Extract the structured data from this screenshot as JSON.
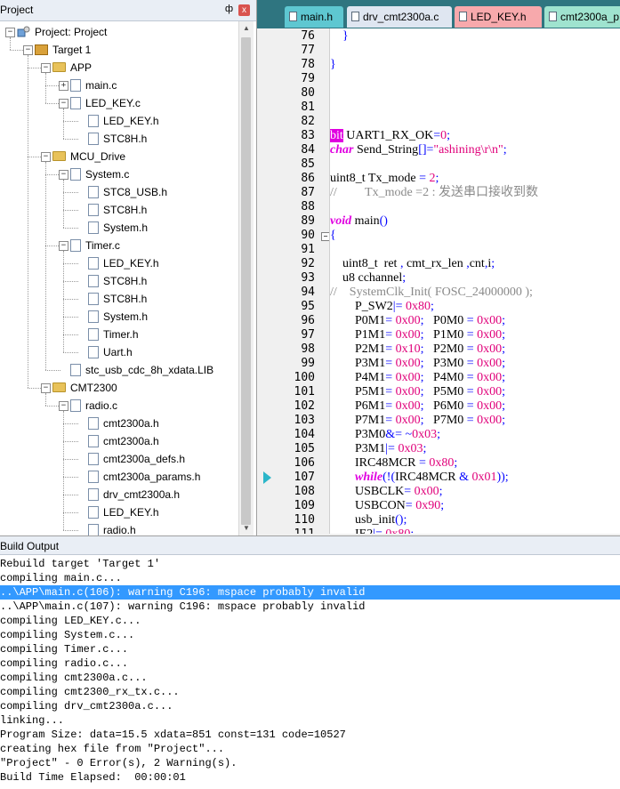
{
  "project_panel": {
    "title": "Project",
    "pin": "ф",
    "close": "x",
    "tree": [
      {
        "label": "Project: Project",
        "type": "project",
        "depth": 0,
        "expander": "−"
      },
      {
        "label": "Target 1",
        "type": "target",
        "depth": 1,
        "expander": "−"
      },
      {
        "label": "APP",
        "type": "folder",
        "depth": 2,
        "expander": "−"
      },
      {
        "label": "main.c",
        "type": "file",
        "depth": 3,
        "expander": "+"
      },
      {
        "label": "LED_KEY.c",
        "type": "file",
        "depth": 3,
        "expander": "−"
      },
      {
        "label": "LED_KEY.h",
        "type": "file",
        "depth": 4
      },
      {
        "label": "STC8H.h",
        "type": "file",
        "depth": 4
      },
      {
        "label": "MCU_Drive",
        "type": "folder",
        "depth": 2,
        "expander": "−"
      },
      {
        "label": "System.c",
        "type": "file",
        "depth": 3,
        "expander": "−"
      },
      {
        "label": "STC8_USB.h",
        "type": "file",
        "depth": 4
      },
      {
        "label": "STC8H.h",
        "type": "file",
        "depth": 4
      },
      {
        "label": "System.h",
        "type": "file",
        "depth": 4
      },
      {
        "label": "Timer.c",
        "type": "file",
        "depth": 3,
        "expander": "−"
      },
      {
        "label": "LED_KEY.h",
        "type": "file",
        "depth": 4
      },
      {
        "label": "STC8H.h",
        "type": "file",
        "depth": 4
      },
      {
        "label": "STC8H.h",
        "type": "file",
        "depth": 4
      },
      {
        "label": "System.h",
        "type": "file",
        "depth": 4
      },
      {
        "label": "Timer.h",
        "type": "file",
        "depth": 4
      },
      {
        "label": "Uart.h",
        "type": "file",
        "depth": 4
      },
      {
        "label": "stc_usb_cdc_8h_xdata.LIB",
        "type": "file",
        "depth": 3
      },
      {
        "label": "CMT2300",
        "type": "folder",
        "depth": 2,
        "expander": "−"
      },
      {
        "label": "radio.c",
        "type": "file",
        "depth": 3,
        "expander": "−"
      },
      {
        "label": "cmt2300a.h",
        "type": "file",
        "depth": 4
      },
      {
        "label": "cmt2300a.h",
        "type": "file",
        "depth": 4
      },
      {
        "label": "cmt2300a_defs.h",
        "type": "file",
        "depth": 4
      },
      {
        "label": "cmt2300a_params.h",
        "type": "file",
        "depth": 4
      },
      {
        "label": "drv_cmt2300a.h",
        "type": "file",
        "depth": 4
      },
      {
        "label": "LED_KEY.h",
        "type": "file",
        "depth": 4
      },
      {
        "label": "radio.h",
        "type": "file",
        "depth": 4
      }
    ]
  },
  "editor": {
    "tabs": [
      {
        "label": "main.h",
        "color": "#5ec7d1",
        "active": true
      },
      {
        "label": "drv_cmt2300a.c",
        "color": "#dfe6f1",
        "active": false
      },
      {
        "label": "LED_KEY.h",
        "color": "#f7a9ac",
        "active": false
      },
      {
        "label": "cmt2300a_p",
        "color": "#9fe3cf",
        "active": false
      }
    ],
    "line_numbers": [
      "76",
      "77",
      "78",
      "79",
      "80",
      "81",
      "82",
      "83",
      "84",
      "85",
      "86",
      "87",
      "88",
      "89",
      "90",
      "91",
      "92",
      "93",
      "94",
      "95",
      "96",
      "97",
      "98",
      "99",
      "100",
      "101",
      "102",
      "103",
      "104",
      "105",
      "106",
      "107",
      "108",
      "109",
      "110",
      "111"
    ],
    "fold_markers": [
      {
        "line": "90",
        "symbol": "−"
      }
    ],
    "current_line_marker": "107",
    "code_lines": [
      [
        {
          "t": "    "
        },
        {
          "t": "}",
          "c": "br"
        }
      ],
      [
        {
          "t": ""
        }
      ],
      [
        {
          "t": "}",
          "c": "br"
        }
      ],
      [
        {
          "t": ""
        }
      ],
      [
        {
          "t": ""
        }
      ],
      [
        {
          "t": ""
        }
      ],
      [
        {
          "t": ""
        }
      ],
      [
        {
          "t": "bit",
          "c": "bitkw"
        },
        {
          "t": " UART1_RX_OK"
        },
        {
          "t": "=",
          "c": "op"
        },
        {
          "t": "0",
          "c": "num"
        },
        {
          "t": ";",
          "c": "op"
        }
      ],
      [
        {
          "t": "char",
          "c": "kw"
        },
        {
          "t": " Send_String"
        },
        {
          "t": "[]=",
          "c": "op"
        },
        {
          "t": "\"ashining\\r\\n\"",
          "c": "str"
        },
        {
          "t": ";",
          "c": "op"
        }
      ],
      [
        {
          "t": ""
        }
      ],
      [
        {
          "t": "uint8_t Tx_mode "
        },
        {
          "t": "=",
          "c": "op"
        },
        {
          "t": " "
        },
        {
          "t": "2",
          "c": "num"
        },
        {
          "t": ";",
          "c": "op"
        }
      ],
      [
        {
          "t": "//         Tx_mode =2 : 发送串口接收到数",
          "c": "cm"
        }
      ],
      [
        {
          "t": ""
        }
      ],
      [
        {
          "t": "void",
          "c": "kw"
        },
        {
          "t": " main"
        },
        {
          "t": "()",
          "c": "op"
        }
      ],
      [
        {
          "t": "{",
          "c": "br"
        }
      ],
      [
        {
          "t": ""
        }
      ],
      [
        {
          "t": "    uint8_t  ret "
        },
        {
          "t": ",",
          "c": "op"
        },
        {
          "t": " cmt_rx_len "
        },
        {
          "t": ",",
          "c": "op"
        },
        {
          "t": "cnt"
        },
        {
          "t": ",",
          "c": "op"
        },
        {
          "t": "i"
        },
        {
          "t": ";",
          "c": "op"
        }
      ],
      [
        {
          "t": "    u8 cchannel"
        },
        {
          "t": ";",
          "c": "op"
        }
      ],
      [
        {
          "t": "//    SystemClk_Init( FOSC_24000000 );",
          "c": "cm"
        }
      ],
      [
        {
          "t": "        P_SW2"
        },
        {
          "t": "|=",
          "c": "op"
        },
        {
          "t": " "
        },
        {
          "t": "0x80",
          "c": "num"
        },
        {
          "t": ";",
          "c": "op"
        }
      ],
      [
        {
          "t": "        P0M1"
        },
        {
          "t": "=",
          "c": "op"
        },
        {
          "t": " "
        },
        {
          "t": "0x00",
          "c": "num"
        },
        {
          "t": ";",
          "c": "op"
        },
        {
          "t": "   P0M0 "
        },
        {
          "t": "=",
          "c": "op"
        },
        {
          "t": " "
        },
        {
          "t": "0x00",
          "c": "num"
        },
        {
          "t": ";",
          "c": "op"
        }
      ],
      [
        {
          "t": "        P1M1"
        },
        {
          "t": "=",
          "c": "op"
        },
        {
          "t": " "
        },
        {
          "t": "0x00",
          "c": "num"
        },
        {
          "t": ";",
          "c": "op"
        },
        {
          "t": "   P1M0 "
        },
        {
          "t": "=",
          "c": "op"
        },
        {
          "t": " "
        },
        {
          "t": "0x00",
          "c": "num"
        },
        {
          "t": ";",
          "c": "op"
        }
      ],
      [
        {
          "t": "        P2M1"
        },
        {
          "t": "=",
          "c": "op"
        },
        {
          "t": " "
        },
        {
          "t": "0x10",
          "c": "num"
        },
        {
          "t": ";",
          "c": "op"
        },
        {
          "t": "   P2M0 "
        },
        {
          "t": "=",
          "c": "op"
        },
        {
          "t": " "
        },
        {
          "t": "0x00",
          "c": "num"
        },
        {
          "t": ";",
          "c": "op"
        }
      ],
      [
        {
          "t": "        P3M1"
        },
        {
          "t": "=",
          "c": "op"
        },
        {
          "t": " "
        },
        {
          "t": "0x00",
          "c": "num"
        },
        {
          "t": ";",
          "c": "op"
        },
        {
          "t": "   P3M0 "
        },
        {
          "t": "=",
          "c": "op"
        },
        {
          "t": " "
        },
        {
          "t": "0x00",
          "c": "num"
        },
        {
          "t": ";",
          "c": "op"
        }
      ],
      [
        {
          "t": "        P4M1"
        },
        {
          "t": "=",
          "c": "op"
        },
        {
          "t": " "
        },
        {
          "t": "0x00",
          "c": "num"
        },
        {
          "t": ";",
          "c": "op"
        },
        {
          "t": "   P4M0 "
        },
        {
          "t": "=",
          "c": "op"
        },
        {
          "t": " "
        },
        {
          "t": "0x00",
          "c": "num"
        },
        {
          "t": ";",
          "c": "op"
        }
      ],
      [
        {
          "t": "        P5M1"
        },
        {
          "t": "=",
          "c": "op"
        },
        {
          "t": " "
        },
        {
          "t": "0x00",
          "c": "num"
        },
        {
          "t": ";",
          "c": "op"
        },
        {
          "t": "   P5M0 "
        },
        {
          "t": "=",
          "c": "op"
        },
        {
          "t": " "
        },
        {
          "t": "0x00",
          "c": "num"
        },
        {
          "t": ";",
          "c": "op"
        }
      ],
      [
        {
          "t": "        P6M1"
        },
        {
          "t": "=",
          "c": "op"
        },
        {
          "t": " "
        },
        {
          "t": "0x00",
          "c": "num"
        },
        {
          "t": ";",
          "c": "op"
        },
        {
          "t": "   P6M0 "
        },
        {
          "t": "=",
          "c": "op"
        },
        {
          "t": " "
        },
        {
          "t": "0x00",
          "c": "num"
        },
        {
          "t": ";",
          "c": "op"
        }
      ],
      [
        {
          "t": "        P7M1"
        },
        {
          "t": "=",
          "c": "op"
        },
        {
          "t": " "
        },
        {
          "t": "0x00",
          "c": "num"
        },
        {
          "t": ";",
          "c": "op"
        },
        {
          "t": "   P7M0 "
        },
        {
          "t": "=",
          "c": "op"
        },
        {
          "t": " "
        },
        {
          "t": "0x00",
          "c": "num"
        },
        {
          "t": ";",
          "c": "op"
        }
      ],
      [
        {
          "t": "        P3M0"
        },
        {
          "t": "&=",
          "c": "op"
        },
        {
          "t": " "
        },
        {
          "t": "~",
          "c": "op"
        },
        {
          "t": "0x03",
          "c": "num"
        },
        {
          "t": ";",
          "c": "op"
        }
      ],
      [
        {
          "t": "        P3M1"
        },
        {
          "t": "|=",
          "c": "op"
        },
        {
          "t": " "
        },
        {
          "t": "0x03",
          "c": "num"
        },
        {
          "t": ";",
          "c": "op"
        }
      ],
      [
        {
          "t": "        IRC48MCR "
        },
        {
          "t": "=",
          "c": "op"
        },
        {
          "t": " "
        },
        {
          "t": "0x80",
          "c": "num"
        },
        {
          "t": ";",
          "c": "op"
        }
      ],
      [
        {
          "t": "        "
        },
        {
          "t": "while",
          "c": "kw"
        },
        {
          "t": "(!(",
          "c": "op"
        },
        {
          "t": "IRC48MCR "
        },
        {
          "t": "&",
          "c": "op"
        },
        {
          "t": " "
        },
        {
          "t": "0x01",
          "c": "num"
        },
        {
          "t": "));",
          "c": "op"
        }
      ],
      [
        {
          "t": "        USBCLK"
        },
        {
          "t": "=",
          "c": "op"
        },
        {
          "t": " "
        },
        {
          "t": "0x00",
          "c": "num"
        },
        {
          "t": ";",
          "c": "op"
        }
      ],
      [
        {
          "t": "        USBCON"
        },
        {
          "t": "=",
          "c": "op"
        },
        {
          "t": " "
        },
        {
          "t": "0x90",
          "c": "num"
        },
        {
          "t": ";",
          "c": "op"
        }
      ],
      [
        {
          "t": "        usb_init"
        },
        {
          "t": "();",
          "c": "op"
        }
      ],
      [
        {
          "t": "        IE2"
        },
        {
          "t": "|=",
          "c": "op"
        },
        {
          "t": " "
        },
        {
          "t": "0x80",
          "c": "num"
        },
        {
          "t": ";",
          "c": "op"
        }
      ]
    ]
  },
  "build_output": {
    "title": "Build Output",
    "selected_line": 2,
    "lines": [
      "Rebuild target 'Target 1'",
      "compiling main.c...",
      "..\\APP\\main.c(106): warning C196: mspace probably invalid",
      "..\\APP\\main.c(107): warning C196: mspace probably invalid",
      "compiling LED_KEY.c...",
      "compiling System.c...",
      "compiling Timer.c...",
      "compiling radio.c...",
      "compiling cmt2300a.c...",
      "compiling cmt2300_rx_tx.c...",
      "compiling drv_cmt2300a.c...",
      "linking...",
      "Program Size: data=15.5 xdata=851 const=131 code=10527",
      "creating hex file from \"Project\"...",
      "\"Project\" - 0 Error(s), 2 Warning(s).",
      "Build Time Elapsed:  00:00:01"
    ]
  }
}
